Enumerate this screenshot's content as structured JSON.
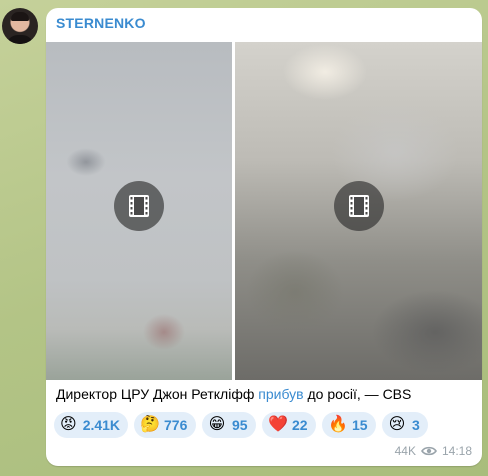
{
  "channel": {
    "name": "STERNENKO"
  },
  "caption": {
    "before": "Директор ЦРУ Джон Реткліфф ",
    "link": "прибув",
    "after": " до росії, — CBS"
  },
  "media": {
    "videos": [
      {
        "icon": "film-icon"
      },
      {
        "icon": "film-icon"
      }
    ]
  },
  "reactions": [
    {
      "emoji": "😡",
      "count": "2.41K"
    },
    {
      "emoji": "🤔",
      "count": "776"
    },
    {
      "emoji": "😁",
      "count": "95"
    },
    {
      "emoji": "❤️",
      "count": "22"
    },
    {
      "emoji": "🔥",
      "count": "15"
    },
    {
      "emoji": "😢",
      "count": "3"
    }
  ],
  "meta": {
    "views": "44K",
    "time": "14:18",
    "views_icon": "eye-icon"
  },
  "colors": {
    "accent": "#3a8bd0",
    "reaction_bg": "#e3eef9",
    "bubble_bg": "#ffffff"
  }
}
